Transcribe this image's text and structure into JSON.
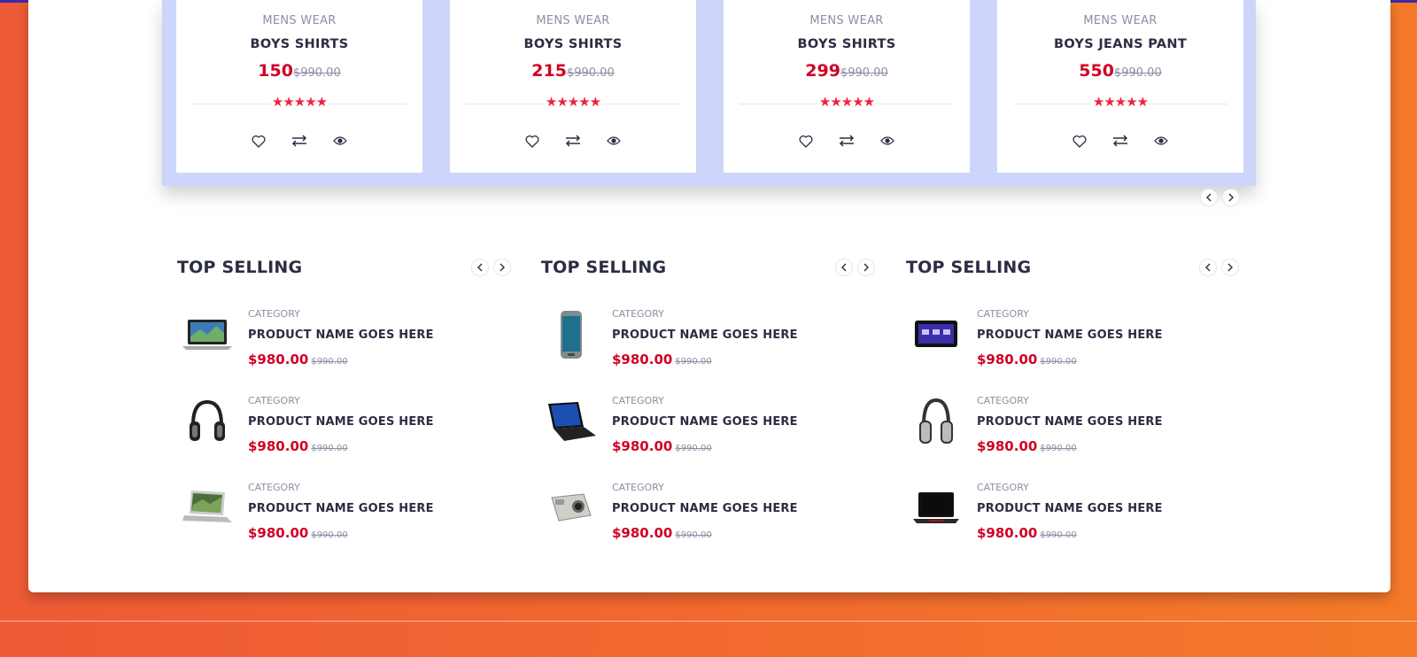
{
  "carousel": {
    "products": [
      {
        "category": "MENS WEAR",
        "name": "BOYS SHIRTS",
        "price": "150",
        "old_price": "$990.00",
        "stars": "★★★★★"
      },
      {
        "category": "MENS WEAR",
        "name": "BOYS SHIRTS",
        "price": "215",
        "old_price": "$990.00",
        "stars": "★★★★★"
      },
      {
        "category": "MENS WEAR",
        "name": "BOYS SHIRTS",
        "price": "299",
        "old_price": "$990.00",
        "stars": "★★★★★"
      },
      {
        "category": "MENS WEAR",
        "name": "BOYS JEANS PANT",
        "price": "550",
        "old_price": "$990.00",
        "stars": "★★★★★"
      }
    ]
  },
  "sections": [
    {
      "title": "TOP SELLING",
      "items": [
        {
          "category": "CATEGORY",
          "name": "PRODUCT NAME GOES HERE",
          "price": "$980.00",
          "old_price": "$990.00",
          "icon": "laptop-icon"
        },
        {
          "category": "CATEGORY",
          "name": "PRODUCT NAME GOES HERE",
          "price": "$980.00",
          "old_price": "$990.00",
          "icon": "headphones-icon"
        },
        {
          "category": "CATEGORY",
          "name": "PRODUCT NAME GOES HERE",
          "price": "$980.00",
          "old_price": "$990.00",
          "icon": "laptop-icon"
        }
      ]
    },
    {
      "title": "TOP SELLING",
      "items": [
        {
          "category": "CATEGORY",
          "name": "PRODUCT NAME GOES HERE",
          "price": "$980.00",
          "old_price": "$990.00",
          "icon": "smartphone-icon"
        },
        {
          "category": "CATEGORY",
          "name": "PRODUCT NAME GOES HERE",
          "price": "$980.00",
          "old_price": "$990.00",
          "icon": "laptop-icon"
        },
        {
          "category": "CATEGORY",
          "name": "PRODUCT NAME GOES HERE",
          "price": "$980.00",
          "old_price": "$990.00",
          "icon": "camera-icon"
        }
      ]
    },
    {
      "title": "TOP SELLING",
      "items": [
        {
          "category": "CATEGORY",
          "name": "PRODUCT NAME GOES HERE",
          "price": "$980.00",
          "old_price": "$990.00",
          "icon": "tablet-icon"
        },
        {
          "category": "CATEGORY",
          "name": "PRODUCT NAME GOES HERE",
          "price": "$980.00",
          "old_price": "$990.00",
          "icon": "headphones-icon"
        },
        {
          "category": "CATEGORY",
          "name": "PRODUCT NAME GOES HERE",
          "price": "$980.00",
          "old_price": "$990.00",
          "icon": "laptop-icon"
        }
      ]
    }
  ],
  "colors": {
    "accent": "#d10024",
    "star": "#ef233c",
    "text_dark": "#2b2d42",
    "text_muted": "#8b8fa3",
    "carousel_bg": "#cdd6fa",
    "page_bg_left": "#ee5a36",
    "page_bg_right": "#f47a2a"
  }
}
